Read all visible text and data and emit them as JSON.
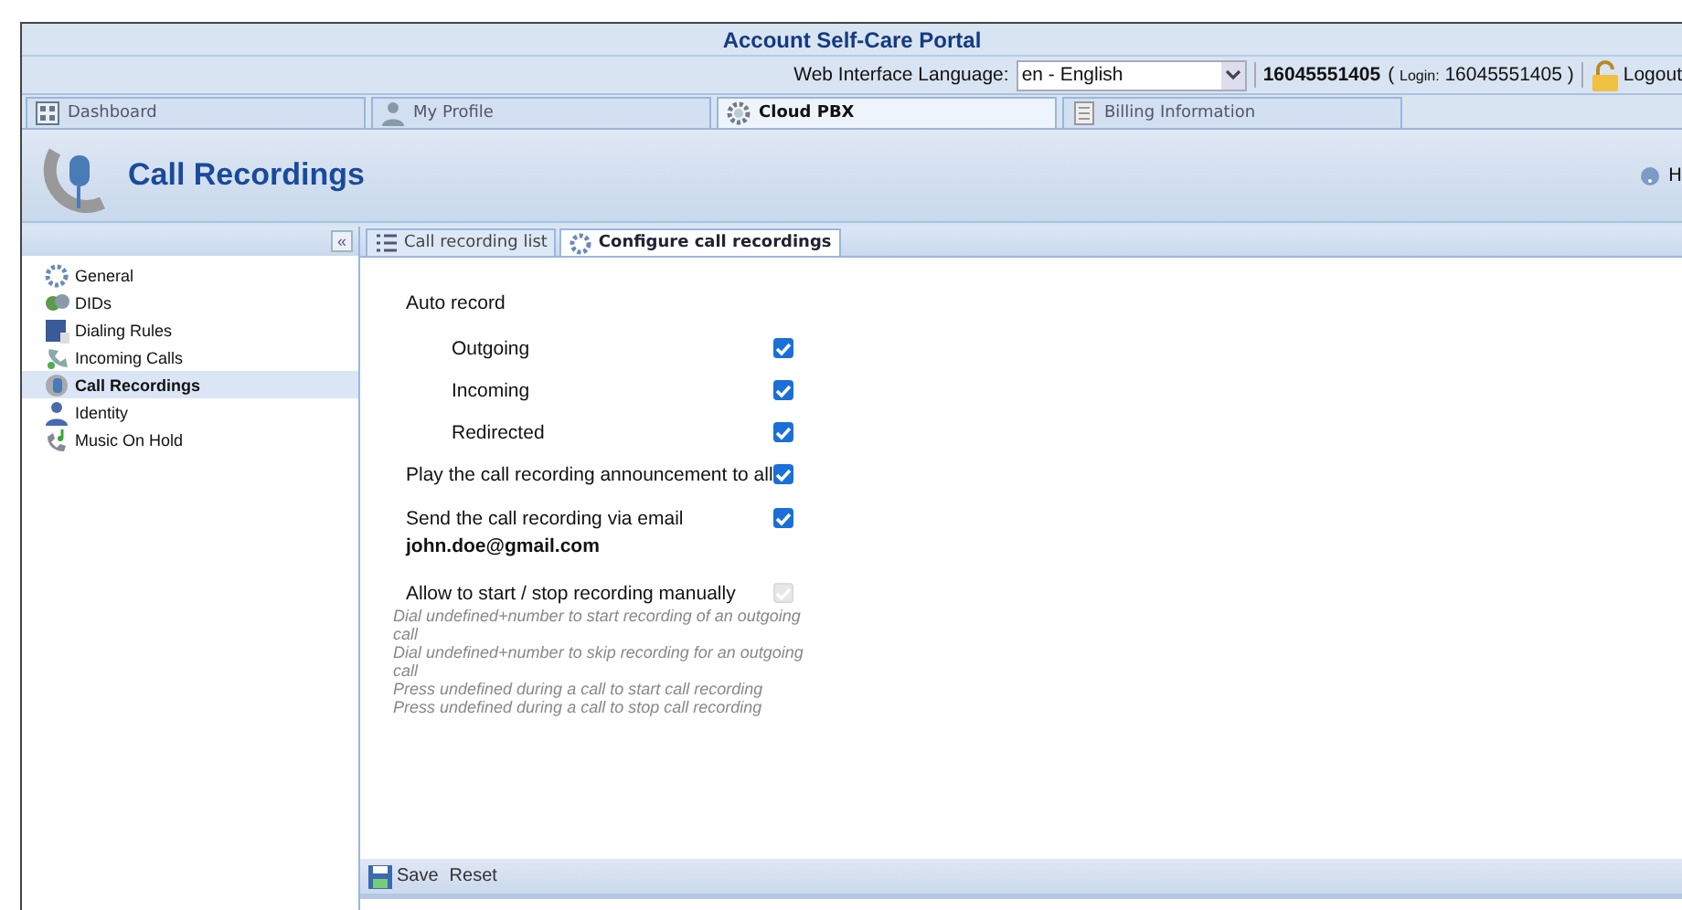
{
  "title": "Account Self-Care Portal",
  "language": {
    "label": "Web Interface Language:",
    "value": "en - English"
  },
  "account": {
    "number": "16045551405",
    "login_open": "(",
    "login_label": "Login:",
    "login_value": "16045551405",
    "login_close": ")"
  },
  "logout": "Logout",
  "tabs": [
    {
      "label": "Dashboard",
      "kind": "grid",
      "selected": false
    },
    {
      "label": "My Profile",
      "kind": "person",
      "selected": false
    },
    {
      "label": "Cloud PBX",
      "kind": "gear",
      "selected": true
    },
    {
      "label": "Billing Information",
      "kind": "doc",
      "selected": false
    }
  ],
  "page_title": "Call Recordings",
  "help": "H",
  "collapse": "«",
  "sidebar": {
    "items": [
      {
        "label": "General",
        "kind": "gear",
        "selected": false
      },
      {
        "label": "DIDs",
        "kind": "dids",
        "selected": false
      },
      {
        "label": "Dialing Rules",
        "kind": "rules",
        "selected": false
      },
      {
        "label": "Incoming Calls",
        "kind": "phone",
        "selected": false
      },
      {
        "label": "Call Recordings",
        "kind": "rec",
        "selected": true
      },
      {
        "label": "Identity",
        "kind": "person",
        "selected": false
      },
      {
        "label": "Music On Hold",
        "kind": "music",
        "selected": false
      }
    ]
  },
  "content_tabs": [
    {
      "label": "Call recording list",
      "kind": "list",
      "selected": false
    },
    {
      "label": "Configure call recordings",
      "kind": "gear",
      "selected": true
    }
  ],
  "form": {
    "heading": "Auto record",
    "options": [
      {
        "label": "Outgoing",
        "kind": "sub",
        "checked": true,
        "disabled": false
      },
      {
        "label": "Incoming",
        "kind": "sub",
        "checked": true,
        "disabled": false
      },
      {
        "label": "Redirected",
        "kind": "sub",
        "checked": true,
        "disabled": false
      },
      {
        "label": "Play the call recording announcement to all",
        "kind": "main",
        "checked": true,
        "disabled": false
      },
      {
        "label": "Send the call recording via email",
        "email": "john.doe@gmail.com",
        "kind": "main",
        "checked": true,
        "disabled": false
      },
      {
        "label": "Allow to start / stop recording manually",
        "kind": "main",
        "checked": true,
        "disabled": true
      }
    ],
    "hints": [
      "Dial undefined+number to start recording of an outgoing call",
      "Dial undefined+number to skip recording for an outgoing call",
      "Press undefined during a call to start call recording",
      "Press undefined during a call to stop call recording"
    ]
  },
  "toolbar": {
    "save": "Save",
    "reset": "Reset"
  }
}
